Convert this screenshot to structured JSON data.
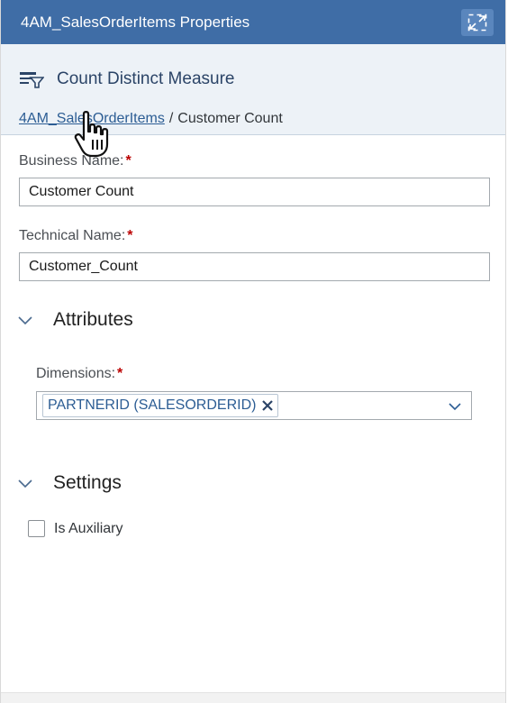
{
  "panel": {
    "title": "4AM_SalesOrderItems Properties",
    "expand_icon": "expand-icon"
  },
  "header": {
    "type_icon": "count-distinct-measure-icon",
    "type_label": "Count Distinct Measure",
    "breadcrumb": {
      "link": "4AM_SalesOrderItems",
      "separator": "/",
      "current": "Customer Count"
    }
  },
  "form": {
    "business_name": {
      "label": "Business Name:",
      "required_mark": "*",
      "value": "Customer Count"
    },
    "technical_name": {
      "label": "Technical Name:",
      "required_mark": "*",
      "value": "Customer_Count"
    }
  },
  "attributes": {
    "title": "Attributes",
    "dimensions": {
      "label": "Dimensions:",
      "required_mark": "*",
      "tokens": [
        "PARTNERID (SALESORDERID)"
      ]
    }
  },
  "settings": {
    "title": "Settings",
    "is_auxiliary": {
      "label": "Is Auxiliary",
      "checked": false
    }
  },
  "colors": {
    "titlebar_bg": "#3f6da6",
    "header_bg": "#edf2f7",
    "link": "#2c5d94",
    "required": "#bb0000"
  }
}
